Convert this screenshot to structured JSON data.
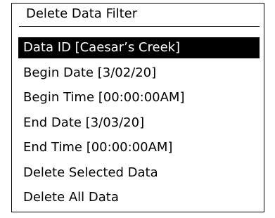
{
  "dialog": {
    "title": "Delete Data Filter",
    "items": [
      {
        "label": "Data ID [Caesar’s Creek]",
        "selected": true
      },
      {
        "label": "Begin Date [3/02/20]",
        "selected": false
      },
      {
        "label": "Begin Time [00:00:00AM]",
        "selected": false
      },
      {
        "label": "End Date [3/03/20]",
        "selected": false
      },
      {
        "label": "End Time [00:00:00AM]",
        "selected": false
      },
      {
        "label": "Delete Selected Data",
        "selected": false
      },
      {
        "label": "Delete All Data",
        "selected": false
      }
    ]
  },
  "colors": {
    "highlight_bg": "#000000",
    "highlight_text": "#ffffff",
    "border": "#000000"
  }
}
